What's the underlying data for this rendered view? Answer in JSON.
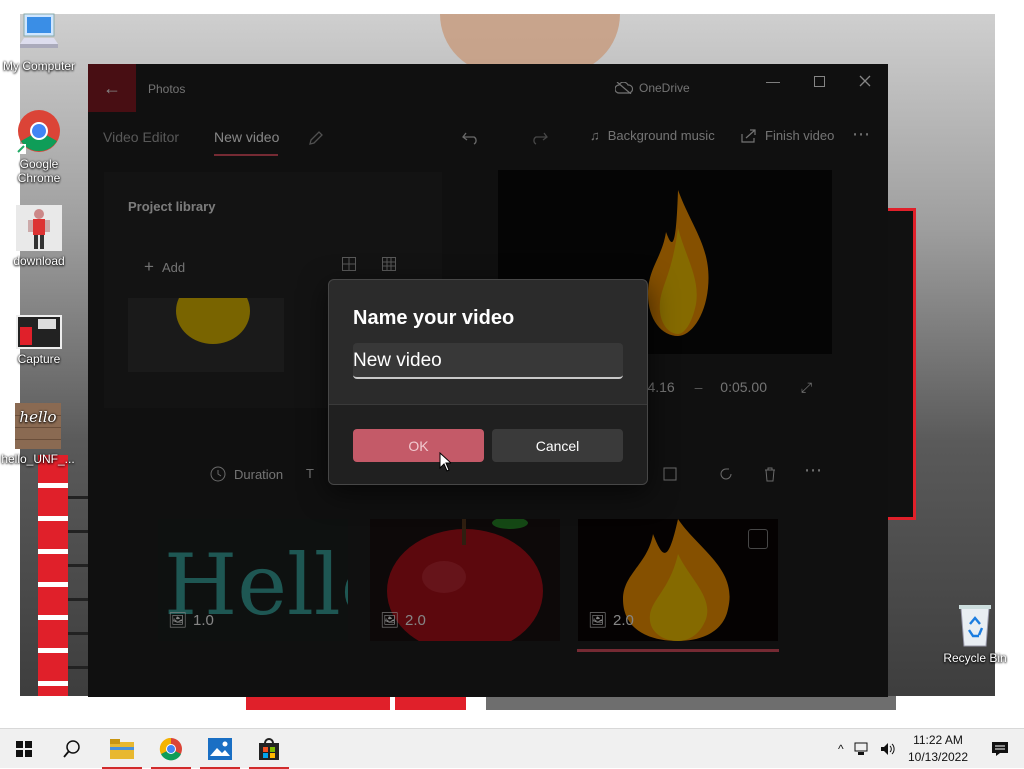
{
  "desktop": {
    "icons": [
      {
        "label": "My Computer"
      },
      {
        "label": "Google Chrome"
      },
      {
        "label": "download"
      },
      {
        "label": "Capture"
      },
      {
        "label": "hello_UNF_..."
      },
      {
        "label": "Recycle Bin"
      }
    ]
  },
  "window": {
    "app_title": "Photos",
    "onedrive_label": "OneDrive",
    "breadcrumb": {
      "parent": "Video Editor",
      "current": "New video"
    },
    "toolbar": {
      "background_music": "Background music",
      "finish_video": "Finish video"
    },
    "project_library": {
      "title": "Project library",
      "add_label": "Add"
    },
    "player": {
      "current_time": "0:04.16",
      "total_time": "0:05.00"
    },
    "storyboard": {
      "duration_label": "Duration",
      "clips": [
        {
          "duration": "1.0",
          "subject": "hello"
        },
        {
          "duration": "2.0",
          "subject": "apple"
        },
        {
          "duration": "2.0",
          "subject": "fire"
        }
      ]
    }
  },
  "dialog": {
    "title": "Name your video",
    "input_value": "New video",
    "ok_label": "OK",
    "cancel_label": "Cancel"
  },
  "taskbar": {
    "time": "11:22 AM",
    "date": "10/13/2022"
  },
  "colors": {
    "accent": "#e05262",
    "ok_button": "#c45a68",
    "window_bg": "#1f1f1f",
    "dialog_bg": "#2b2b2b"
  }
}
